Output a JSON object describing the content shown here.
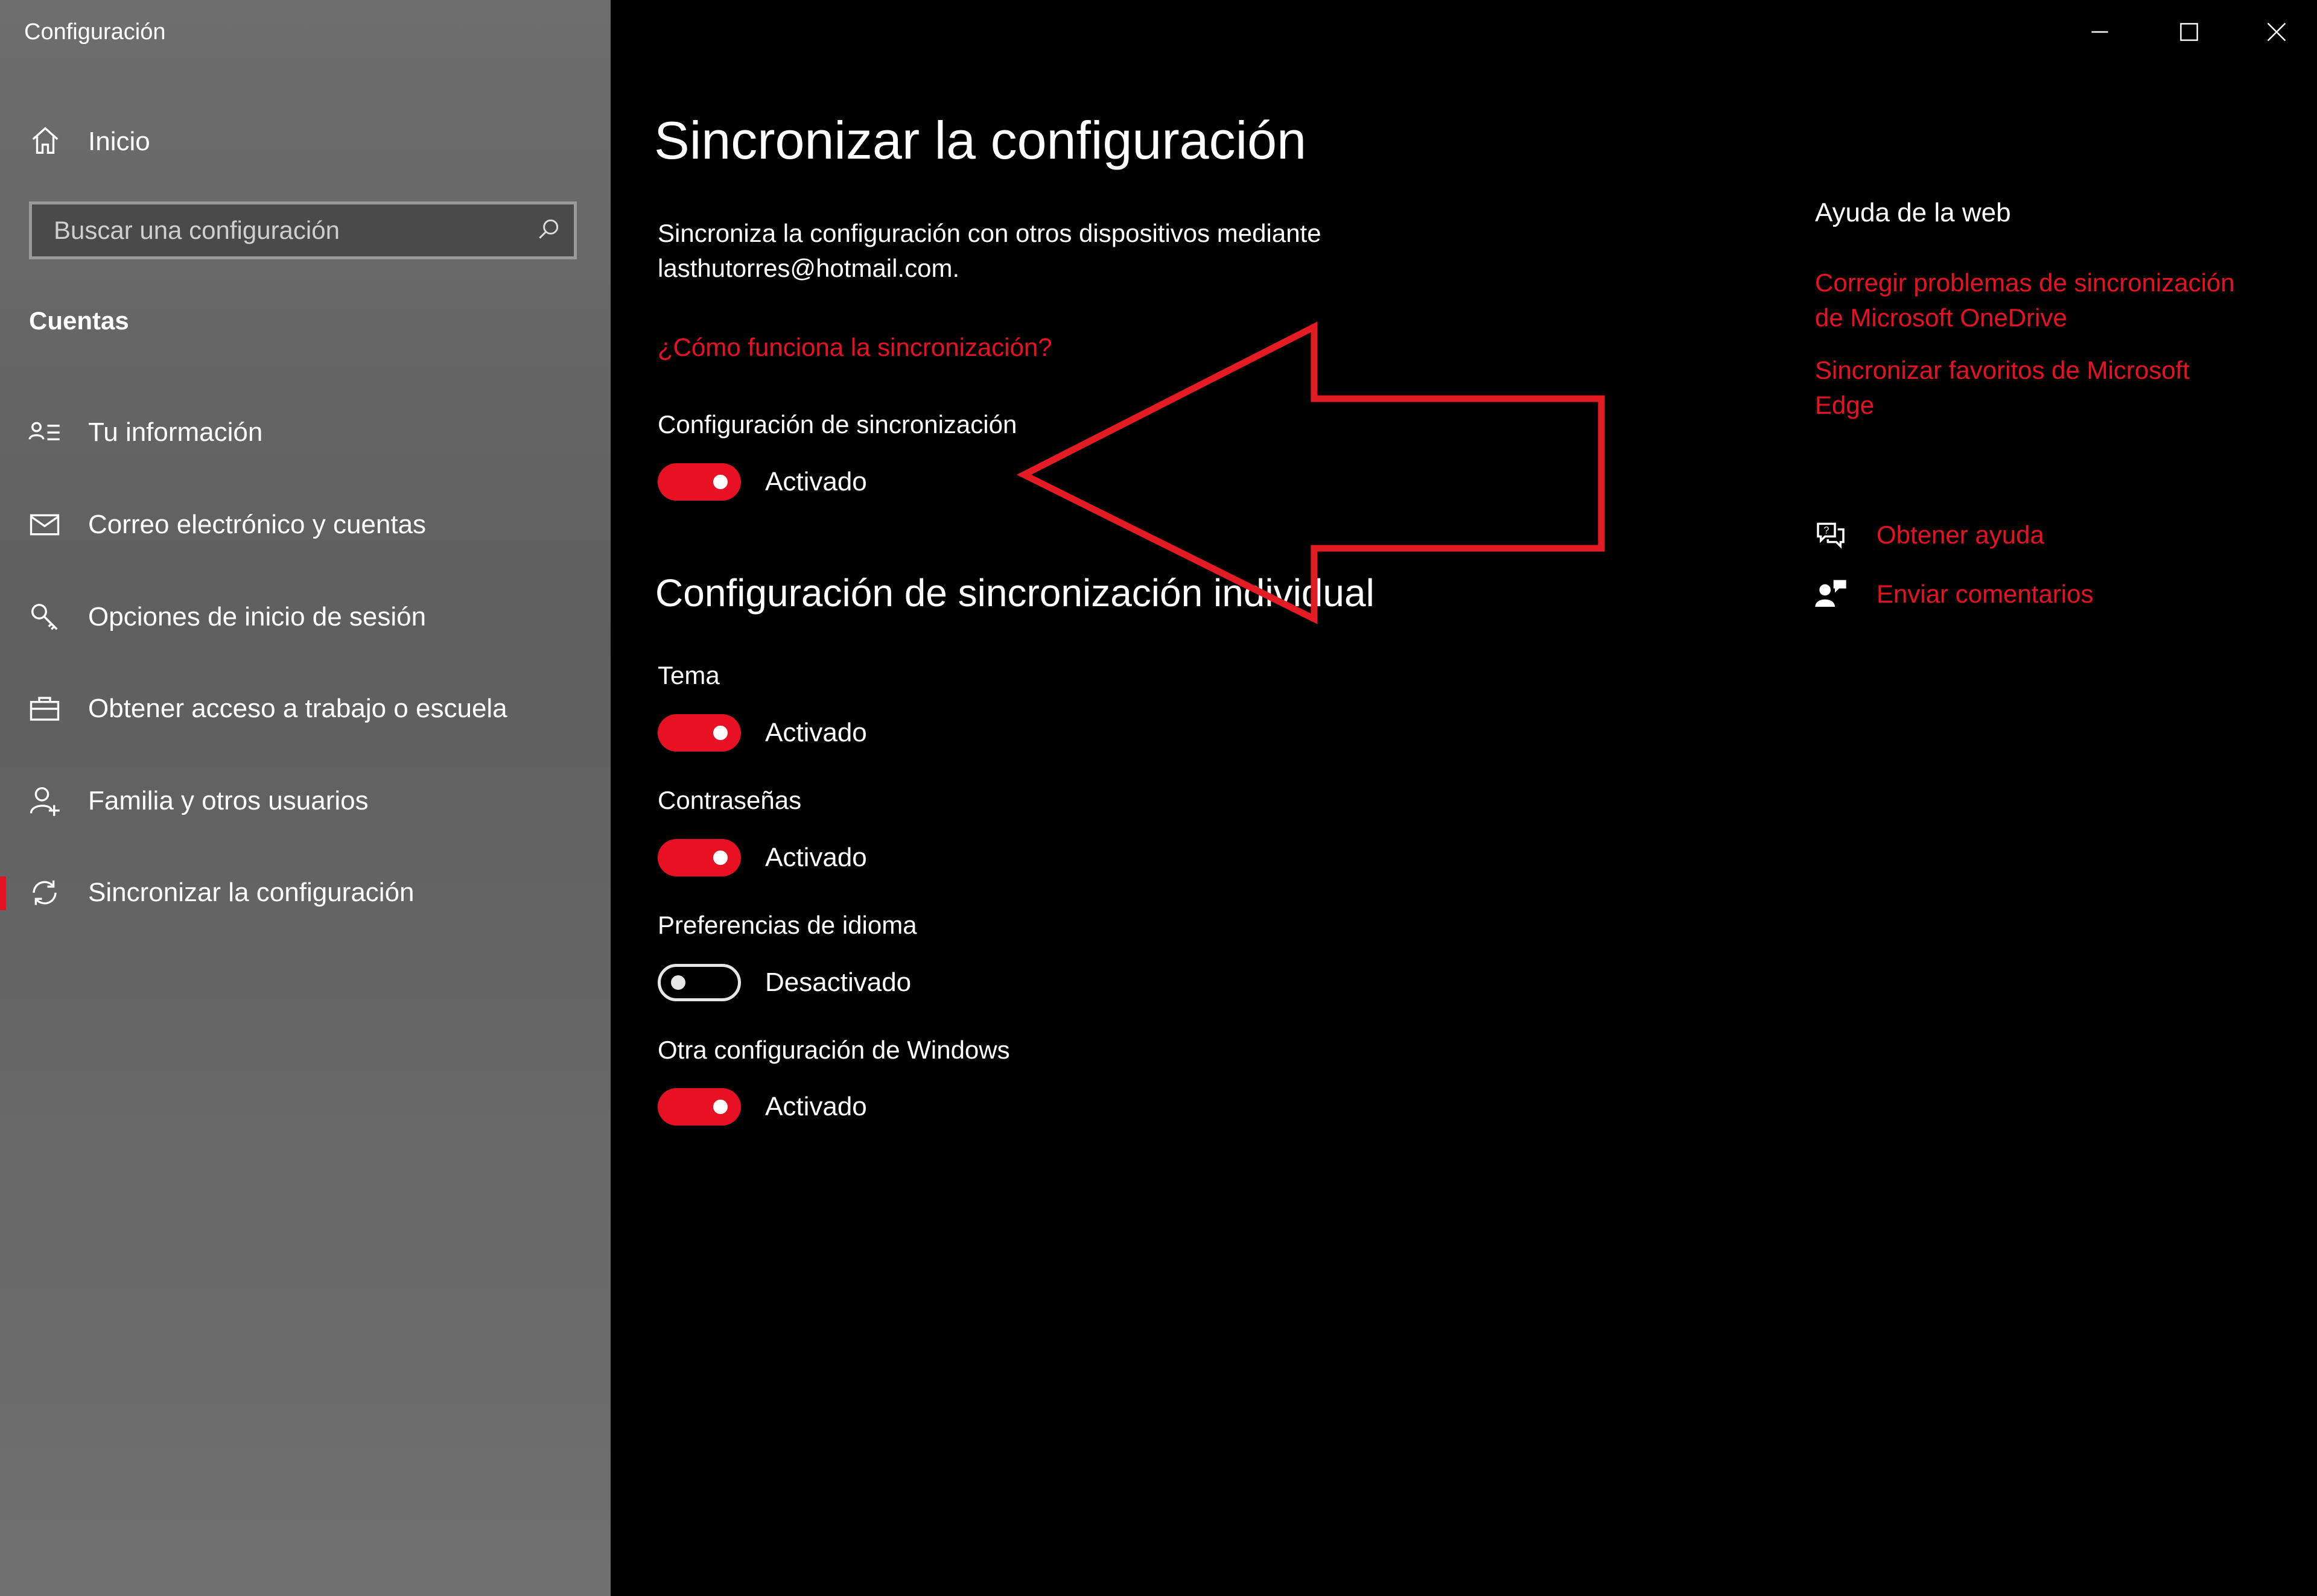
{
  "window": {
    "title": "Configuración",
    "controls": [
      "minimize-icon",
      "maximize-icon",
      "close-icon"
    ]
  },
  "sidebar": {
    "home_label": "Inicio",
    "search_placeholder": "Buscar una configuración",
    "section_label": "Cuentas",
    "items": [
      {
        "label": "Tu información",
        "icon": "contact-info-icon",
        "active": false
      },
      {
        "label": "Correo electrónico y cuentas",
        "icon": "mail-icon",
        "active": false
      },
      {
        "label": "Opciones de inicio de sesión",
        "icon": "key-icon",
        "active": false
      },
      {
        "label": "Obtener acceso a trabajo o escuela",
        "icon": "briefcase-icon",
        "active": false
      },
      {
        "label": "Familia y otros usuarios",
        "icon": "add-person-icon",
        "active": false
      },
      {
        "label": "Sincronizar la configuración",
        "icon": "sync-icon",
        "active": true
      }
    ]
  },
  "main": {
    "title": "Sincronizar la configuración",
    "description_line1": "Sincroniza la configuración con otros dispositivos mediante",
    "description_line2": "lasthutorres@hotmail.com.",
    "how_link": "¿Cómo funciona la sincronización?",
    "sync_settings": {
      "label": "Configuración de sincronización",
      "state": "Activado",
      "on": true
    },
    "individual_heading": "Configuración de sincronización individual",
    "individual": [
      {
        "label": "Tema",
        "state": "Activado",
        "on": true
      },
      {
        "label": "Contraseñas",
        "state": "Activado",
        "on": true
      },
      {
        "label": "Preferencias de idioma",
        "state": "Desactivado",
        "on": false
      },
      {
        "label": "Otra configuración de Windows",
        "state": "Activado",
        "on": true
      }
    ]
  },
  "help": {
    "title": "Ayuda de la web",
    "links": [
      {
        "line1": "Corregir problemas de sincronización",
        "line2": "de Microsoft OneDrive"
      },
      {
        "line1": "Sincronizar favoritos de Microsoft",
        "line2": "Edge"
      }
    ],
    "get_help": "Obtener ayuda",
    "feedback": "Enviar comentarios"
  },
  "colors": {
    "accent": "#e81123",
    "annotation": "#e31b23",
    "background": "#000000",
    "sidebar": "#6a6a6a"
  },
  "annotation": {
    "type": "arrow",
    "pointing": "left",
    "target": "sync-settings-toggle"
  }
}
